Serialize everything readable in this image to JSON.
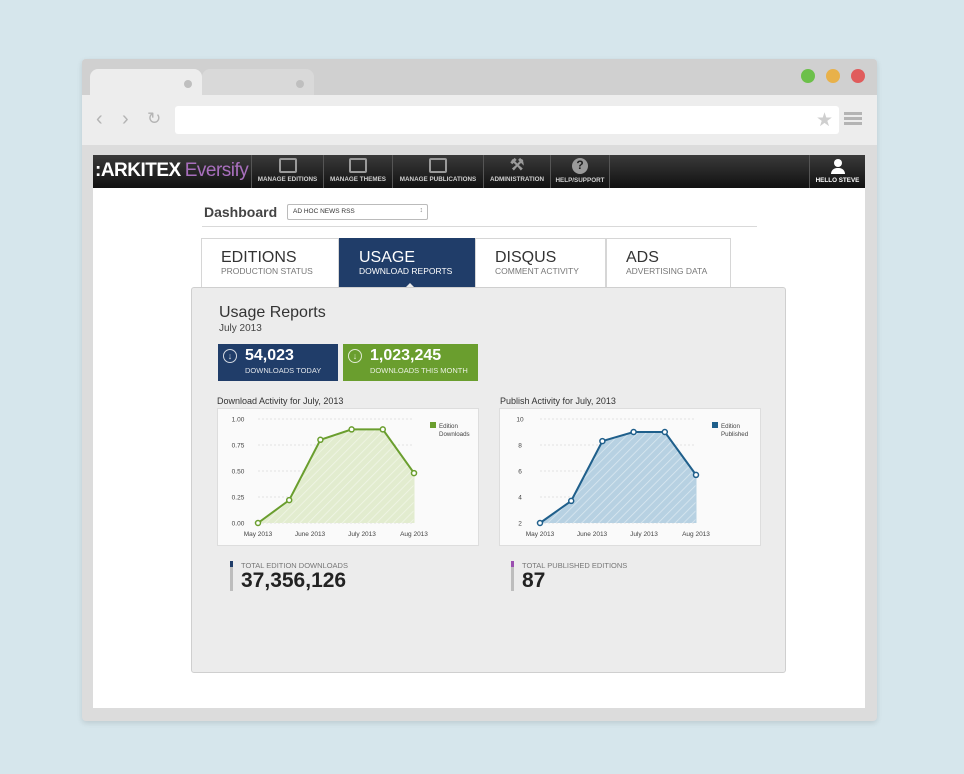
{
  "browser": {
    "traffic_colors": [
      "#6cc04a",
      "#e8b14a",
      "#e05c5c"
    ],
    "nav_icons": [
      "back-icon",
      "forward-icon",
      "reload-icon"
    ]
  },
  "app": {
    "logo_primary": ":ARKITEX",
    "logo_secondary": "Eversify",
    "nav_items": [
      {
        "label": "MANAGE EDITIONS",
        "icon": "editions-icon"
      },
      {
        "label": "MANAGE THEMES",
        "icon": "themes-icon"
      },
      {
        "label": "MANAGE PUBLICATIONS",
        "icon": "publications-icon"
      },
      {
        "label": "ADMINISTRATION",
        "icon": "tools-icon"
      },
      {
        "label": "HELP/SUPPORT",
        "icon": "help-icon"
      }
    ],
    "user_label": "HELLO STEVE"
  },
  "dashboard": {
    "title": "Dashboard",
    "publication_select": "AD HOC NEWS RSS"
  },
  "tabs": [
    {
      "title": "EDITIONS",
      "subtitle": "PRODUCTION STATUS"
    },
    {
      "title": "USAGE",
      "subtitle": "DOWNLOAD REPORTS"
    },
    {
      "title": "DISQUS",
      "subtitle": "COMMENT ACTIVITY"
    },
    {
      "title": "ADS",
      "subtitle": "ADVERTISING DATA"
    }
  ],
  "report": {
    "title": "Usage Reports",
    "period": "July 2013",
    "stats": [
      {
        "value": "54,023",
        "label": "DOWNLOADS TODAY",
        "color": "#203d69"
      },
      {
        "value": "1,023,245",
        "label": "DOWNLOADS THIS MONTH",
        "color": "#6a9e2e"
      }
    ],
    "totals": [
      {
        "label": "TOTAL EDITION DOWNLOADS",
        "value": "37,356,126",
        "color": "#203d69"
      },
      {
        "label": "TOTAL PUBLISHED EDITIONS",
        "value": "87",
        "color": "#9b4fb0"
      }
    ]
  },
  "chart_data": [
    {
      "type": "area",
      "title": "Download Activity for July, 2013",
      "x": [
        "May 2013",
        "",
        "June 2013",
        "",
        "July 2013",
        "",
        "Aug 2013"
      ],
      "x_ticks": [
        "May 2013",
        "June 2013",
        "July 2013",
        "Aug 2013"
      ],
      "series": [
        {
          "name": "Edition Downloads",
          "values": [
            0.0,
            0.22,
            0.8,
            0.9,
            0.9,
            0.48
          ]
        }
      ],
      "ylim": [
        0,
        1.0
      ],
      "y_ticks": [
        "1.00",
        "0.75",
        "0.50",
        "0.25",
        "0.00"
      ],
      "color": "#6a9e2e",
      "fill": "#e2eccf",
      "legend": "top-right",
      "grid": true
    },
    {
      "type": "area",
      "title": "Publish Activity for July, 2013",
      "x_ticks": [
        "May 2013",
        "June 2013",
        "July 2013",
        "Aug 2013"
      ],
      "series": [
        {
          "name": "Edition Published",
          "values": [
            2.0,
            3.7,
            8.3,
            9.0,
            9.0,
            5.7
          ]
        }
      ],
      "ylim": [
        2,
        10
      ],
      "y_ticks": [
        "10",
        "8",
        "6",
        "4",
        "2"
      ],
      "color": "#1f5f8b",
      "fill": "#b7d1e2",
      "legend": "top-right",
      "grid": true
    }
  ]
}
